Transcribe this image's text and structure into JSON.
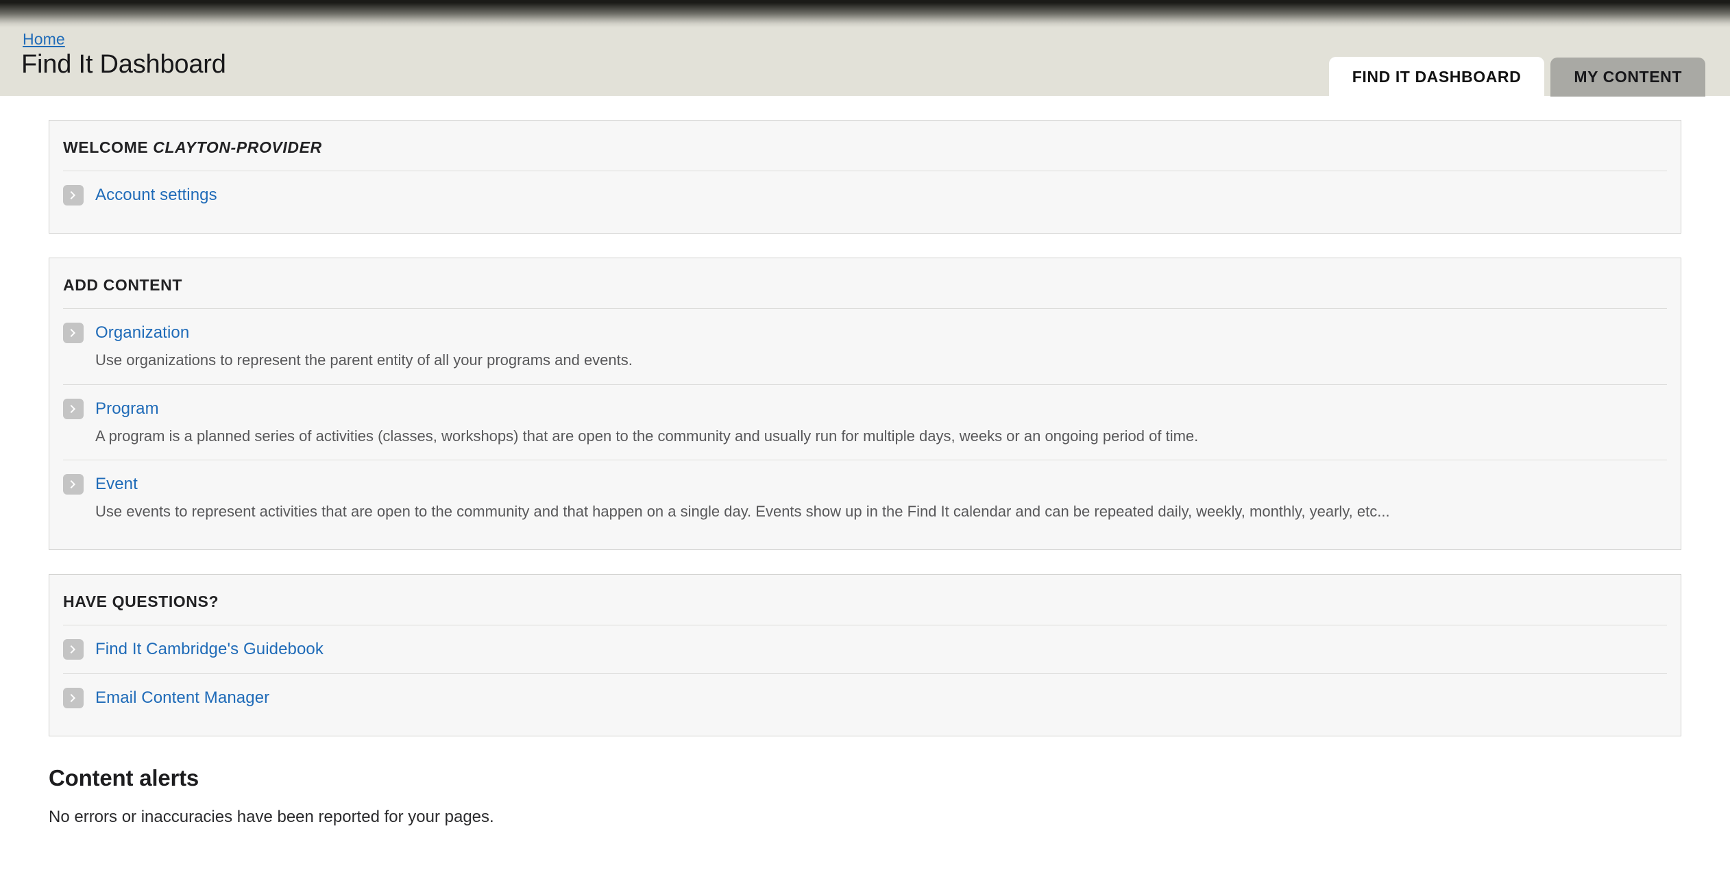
{
  "header": {
    "breadcrumb": "Home",
    "title": "Find It Dashboard",
    "tabs": [
      {
        "label": "FIND IT DASHBOARD",
        "active": true
      },
      {
        "label": "MY CONTENT",
        "active": false
      }
    ]
  },
  "welcome_panel": {
    "title_prefix": "WELCOME ",
    "title_user": "CLAYTON-PROVIDER",
    "links": [
      {
        "label": "Account settings",
        "icon": "chevron-right-icon"
      }
    ]
  },
  "add_content_panel": {
    "title": "ADD CONTENT",
    "items": [
      {
        "label": "Organization",
        "icon": "chevron-right-icon",
        "description": "Use organizations to represent the parent entity of all your programs and events."
      },
      {
        "label": "Program",
        "icon": "chevron-right-icon",
        "description": "A program is a planned series of activities (classes, workshops) that are open to the community and usually run for multiple days, weeks or an ongoing period of time."
      },
      {
        "label": "Event",
        "icon": "chevron-right-icon",
        "description": "Use events to represent activities that are open to the community and that happen on a single day. Events show up in the Find It calendar and can be repeated daily, weekly, monthly, yearly, etc..."
      }
    ]
  },
  "questions_panel": {
    "title": "HAVE QUESTIONS?",
    "items": [
      {
        "label": "Find It Cambridge's Guidebook",
        "icon": "chevron-right-icon"
      },
      {
        "label": "Email Content Manager",
        "icon": "chevron-right-icon"
      }
    ]
  },
  "content_alerts": {
    "title": "Content alerts",
    "message": "No errors or inaccuracies have been reported for your pages."
  },
  "colors": {
    "link": "#1f6bb8",
    "header_bg": "#e2e1d8",
    "panel_bg": "#f7f7f7",
    "panel_border": "#d2d2d0",
    "inactive_tab": "#a9a9a4",
    "chevron_box": "#c4c4c4"
  }
}
